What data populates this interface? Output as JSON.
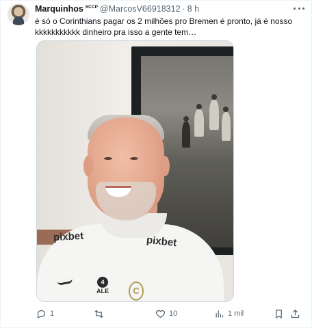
{
  "tweet": {
    "display_name": "Marquinhos",
    "badge_text": "SCCP",
    "handle": "@MarcosV66918312",
    "separator": "·",
    "time": "8 h",
    "text": "é só o Corinthians pagar os 2 milhões pro Bremen é pronto, já é nosso kkkkkkkkkkk dinheiro pra isso a gente tem…",
    "media": {
      "sponsor_left": "pixbet",
      "sponsor_right": "pixbet",
      "chest_logo_symbol": "4",
      "chest_logo_text": "ALE",
      "crest_letter": "C"
    },
    "actions": {
      "reply_count": "1",
      "repost_count": "",
      "like_count": "10",
      "views_count": "1 mil"
    }
  },
  "icons": {
    "more": "more-horizontal-icon",
    "reply": "reply-icon",
    "repost": "repost-icon",
    "like": "heart-icon",
    "views": "views-icon",
    "bookmark": "bookmark-icon",
    "share": "share-icon"
  },
  "colors": {
    "text_primary": "#0f1419",
    "text_secondary": "#536471",
    "border": "#eff3f4"
  }
}
